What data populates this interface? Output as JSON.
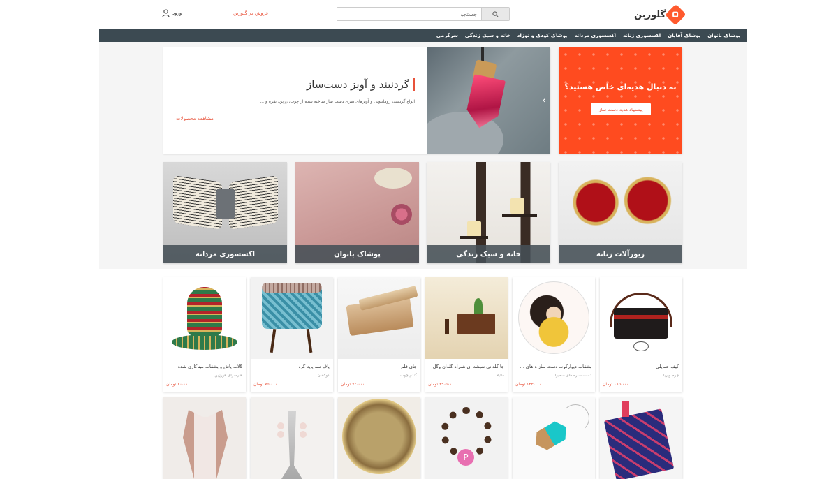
{
  "header": {
    "logo_text": "گلوربن",
    "search_placeholder": "جستجو",
    "sell_link": "فروش در گلوربن",
    "login_label": "ورود"
  },
  "nav": {
    "items": [
      "پوشاک بانوان",
      "پوشاک آقایان",
      "اکسسوری زنانه",
      "اکسسوری مردانه",
      "پوشاک کودک و نوزاد",
      "خانه و سبک زندگی",
      "سرگرمی"
    ]
  },
  "hero": {
    "title": "گردنبند و آویز دست‌ساز",
    "description": "انواع گردنبند، رومانتویی و آویزهای هنری دست ساز ساخته شده از چوب، رزین، نقره و ...",
    "link": "مشاهده محصولات"
  },
  "promo": {
    "title": "به دنبال هدیه‌ای خاص هستید؟",
    "button": "پیشنهاد هدیه دست ساز"
  },
  "categories": [
    "زیورآلات زنانه",
    "خانه و سبک زندگی",
    "پوشاک بانوان",
    "اکسسوری مردانه"
  ],
  "products": [
    {
      "title": "کیف حمایلی",
      "shop": "چرم ویریا",
      "price": "۱۸۵،۰۰۰ تومان"
    },
    {
      "title": "بشقاب دیوارکوب دست ساز ه های س...",
      "shop": "دست ساره های سمیرا",
      "price": "۱۳۳،۰۰۰ تومان"
    },
    {
      "title": "جا گلدانی شیشه ای،همراه گلدان وگل",
      "shop": "ماتیلا",
      "price": "۳۹،۵۰۰ تومان"
    },
    {
      "title": "جای قلم",
      "shop": "گندم چوب",
      "price": "۷۲،۰۰۰ تومان"
    },
    {
      "title": "پاف سه پایه گرد",
      "shop": "کوکخان",
      "price": "۷۵،۰۰۰ تومان"
    },
    {
      "title": "گلاب پاش و بشقاب میناکاری شده",
      "shop": "هنرسرای هورزین",
      "price": "۶۰،۰۰۰ تومان"
    }
  ],
  "colors": {
    "accent": "#e8523a",
    "nav_bg": "#3c4a52",
    "promo_bg": "#ff4b1f"
  }
}
